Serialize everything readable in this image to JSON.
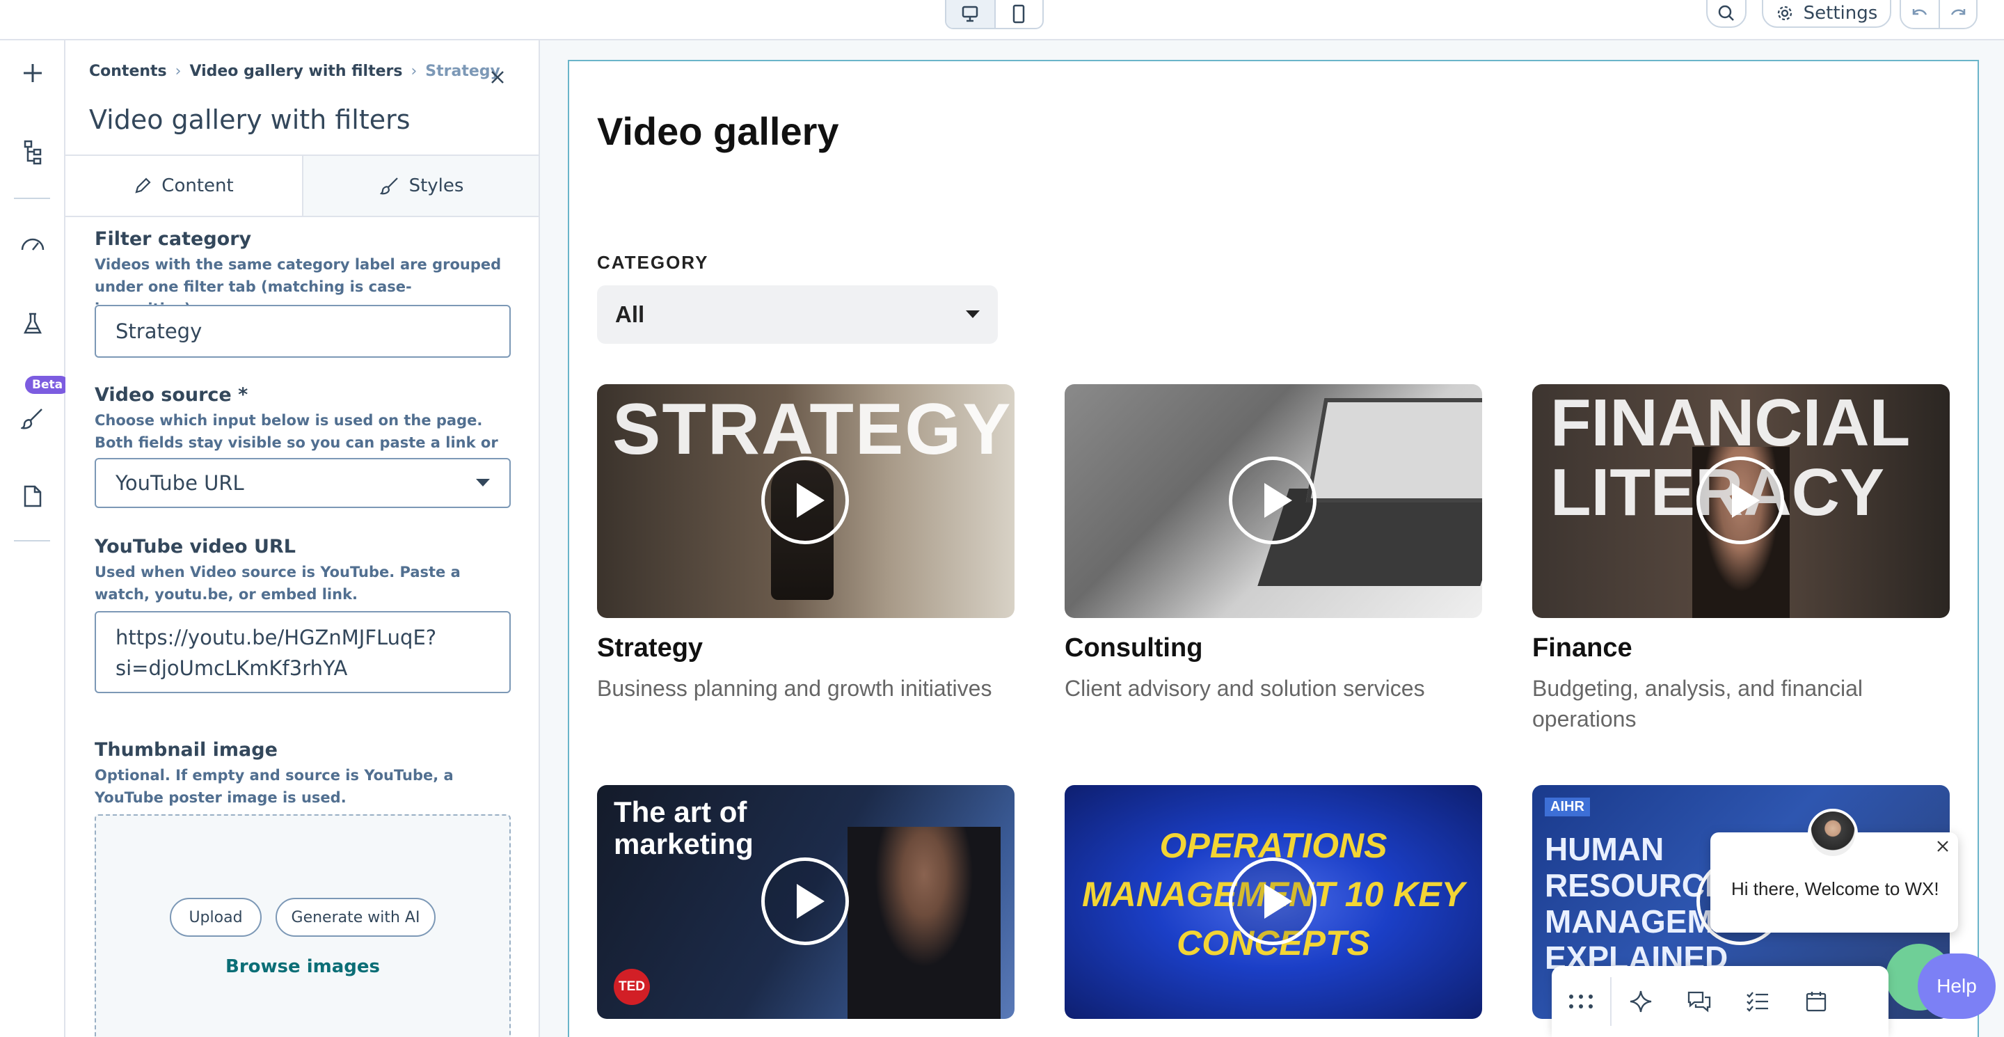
{
  "topbar": {
    "view_buttons": [
      "desktop-icon",
      "mobile-icon"
    ],
    "settings_label": "Settings"
  },
  "rail": {
    "items": [
      "plus-icon",
      "tree-icon",
      "gauge-icon",
      "flask-icon",
      "brush-icon",
      "page-icon"
    ],
    "beta_badge": "Beta"
  },
  "panel": {
    "breadcrumbs": [
      "Contents",
      "Video gallery with filters",
      "Strategy"
    ],
    "title": "Video gallery with filters",
    "tabs": {
      "content": "Content",
      "styles": "Styles"
    },
    "filter_category": {
      "label": "Filter category",
      "help": "Videos with the same category label are grouped under one filter tab (matching is case-insensitive).",
      "value": "Strategy"
    },
    "video_source": {
      "label": "Video source *",
      "help": "Choose which input below is used on the page. Both fields stay visible so you can paste a link or pick a file.",
      "value": "YouTube URL"
    },
    "youtube_url": {
      "label": "YouTube video URL",
      "help": "Used when Video source is YouTube. Paste a watch, youtu.be, or embed link.",
      "value": "https://youtu.be/HGZnMJFLuqE?\nsi=djoUmcLKmKf3rhYA"
    },
    "thumbnail": {
      "label": "Thumbnail image",
      "help": "Optional. If empty and source is YouTube, a YouTube poster image is used.",
      "upload": "Upload",
      "generate": "Generate with AI",
      "browse": "Browse images"
    }
  },
  "preview": {
    "title": "Video gallery",
    "category_label": "CATEGORY",
    "category_value": "All",
    "cards": [
      {
        "title": "Strategy",
        "desc": "Business planning and growth initiatives",
        "overlay": "STRATEGY"
      },
      {
        "title": "Consulting",
        "desc": "Client advisory and solution services",
        "overlay": ""
      },
      {
        "title": "Finance",
        "desc": "Budgeting, analysis, and financial operations",
        "overlay": "FINANCIAL LITERACY"
      },
      {
        "title": "",
        "desc": "",
        "overlay": "The art of marketing",
        "badge": "TED"
      },
      {
        "title": "",
        "desc": "",
        "overlay": "OPERATIONS MANAGEMENT 10 KEY CONCEPTS"
      },
      {
        "title": "",
        "desc": "",
        "overlay": "HUMAN RESOURCE MANAGEMENT EXPLAINED",
        "badge": "AIHR"
      }
    ]
  },
  "chat": {
    "message": "Hi there, Welcome to WX!",
    "help_label": "Help"
  },
  "colors": {
    "accent_teal": "#0b6e76",
    "frame_border": "#6ab4c9",
    "beta_purple": "#7c5ce0",
    "help_button": "#7c80f5"
  }
}
